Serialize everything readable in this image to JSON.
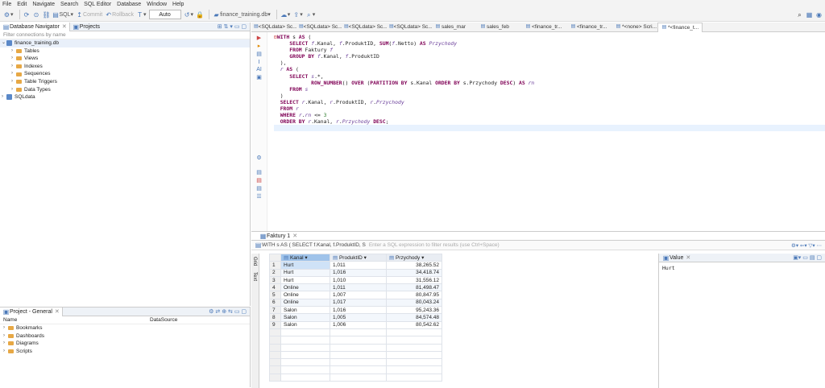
{
  "menu": [
    "File",
    "Edit",
    "Navigate",
    "Search",
    "SQL Editor",
    "Database",
    "Window",
    "Help"
  ],
  "toolbar": {
    "sql": "SQL",
    "commit": "Commit",
    "rollback": "Rollback",
    "auto": "Auto",
    "db": "finance_training.db"
  },
  "navigator": {
    "tab1": "Database Navigator",
    "tab2": "Projects",
    "filter_placeholder": "Filter connections by name",
    "db": "finance_training.db",
    "items": [
      "Tables",
      "Views",
      "Indexes",
      "Sequences",
      "Table Triggers",
      "Data Types"
    ],
    "other_db": "SQLdata"
  },
  "project": {
    "title": "Project - General",
    "col_name": "Name",
    "col_source": "DataSource",
    "items": [
      "Bookmarks",
      "Dashboards",
      "Diagrams",
      "Scripts"
    ]
  },
  "editor_tabs": [
    "<SQLdata> Sc...",
    "<SQLdata> Sc...",
    "<SQLdata> Sc...",
    "<SQLdata> Sc...",
    "sales_mar",
    "sales_feb",
    "<finance_tr...",
    "<finance_tr...",
    "*<none> Scri...",
    "*<finance_t..."
  ],
  "results": {
    "tab": "Faktury 1",
    "filter_query": "WITH s AS ( SELECT f.Kanal, f.ProduktID, S",
    "filter_placeholder": "Enter a SQL expression to filter results (use Ctrl+Space)",
    "columns": [
      "Kanal",
      "ProduktID",
      "Przychody"
    ],
    "rows": [
      [
        "Hurt",
        "1,011",
        "38,265.52"
      ],
      [
        "Hurt",
        "1,016",
        "34,418.74"
      ],
      [
        "Hurt",
        "1,010",
        "31,556.12"
      ],
      [
        "Online",
        "1,011",
        "81,498.47"
      ],
      [
        "Online",
        "1,007",
        "80,847.95"
      ],
      [
        "Online",
        "1,017",
        "80,043.24"
      ],
      [
        "Salon",
        "1,016",
        "95,243.36"
      ],
      [
        "Salon",
        "1,005",
        "84,574.48"
      ],
      [
        "Salon",
        "1,006",
        "80,542.62"
      ]
    ],
    "value_title": "Value",
    "value": "Hurt"
  }
}
